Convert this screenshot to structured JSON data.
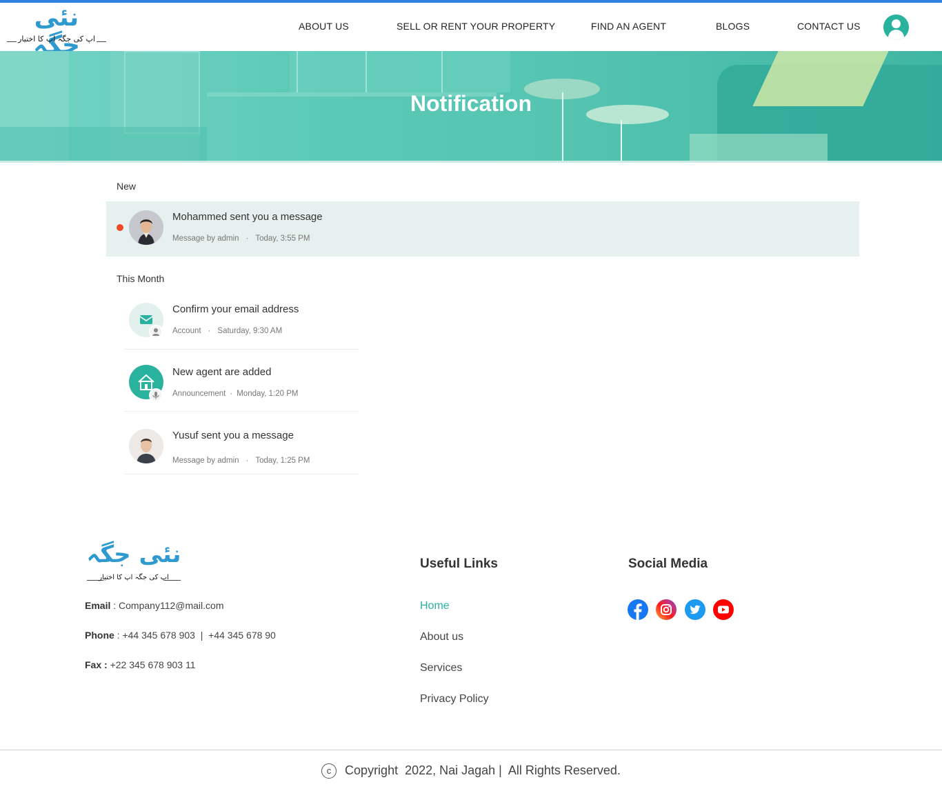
{
  "brand": {
    "logo_main": "نئی جگہ",
    "logo_sub": "اپ کی جگہ اپ کا اختیار"
  },
  "nav": {
    "items": [
      {
        "label": "ABOUT US"
      },
      {
        "label": "SELL OR RENT YOUR PROPERTY"
      },
      {
        "label": "FIND AN AGENT"
      },
      {
        "label": "BLOGS"
      },
      {
        "label": "CONTACT US"
      }
    ],
    "account_icon": "user-circle-icon"
  },
  "hero": {
    "title": "Notification"
  },
  "notifications": {
    "new_label": "New",
    "this_month_label": "This Month",
    "new_items": [
      {
        "title": "Mohammed sent you a message",
        "category": "Message by admin",
        "time": "Today, 3:55 PM",
        "unread": true,
        "icon": "avatar"
      }
    ],
    "month_items": [
      {
        "title": "Confirm your email address",
        "category": "Account",
        "time": "Saturday, 9:30 AM",
        "icon": "mail-icon",
        "badge": "user-icon"
      },
      {
        "title": "New agent are added",
        "category": "Announcement",
        "time": "Monday, 1:20 PM",
        "icon": "house-icon",
        "badge": "microphone-icon"
      },
      {
        "title": "Yusuf sent you a message",
        "category": "Message by admin",
        "time": "Today, 1:25 PM",
        "icon": "avatar"
      }
    ]
  },
  "footer": {
    "email_label": "Email",
    "email": "Company112@mail.com",
    "phone_label": "Phone",
    "phone": "+44 345 678 903  |  +44 345 678 90",
    "fax_label": "Fax :",
    "fax": "+22 345 678 903 11",
    "useful_links_title": "Useful Links",
    "links": [
      {
        "label": "Home",
        "active": true
      },
      {
        "label": "About us"
      },
      {
        "label": "Services"
      },
      {
        "label": "Privacy Policy"
      }
    ],
    "social_title": "Social Media",
    "social": [
      "facebook-icon",
      "instagram-icon",
      "twitter-icon",
      "youtube-icon"
    ],
    "copyright": "Copyright  2022, Nai Jagah |  All Rights Reserved."
  },
  "colors": {
    "accent": "#29b29d",
    "topbar": "#2f80e0",
    "unread": "#ef4a23",
    "highlight_row": "#e6f0ee"
  }
}
